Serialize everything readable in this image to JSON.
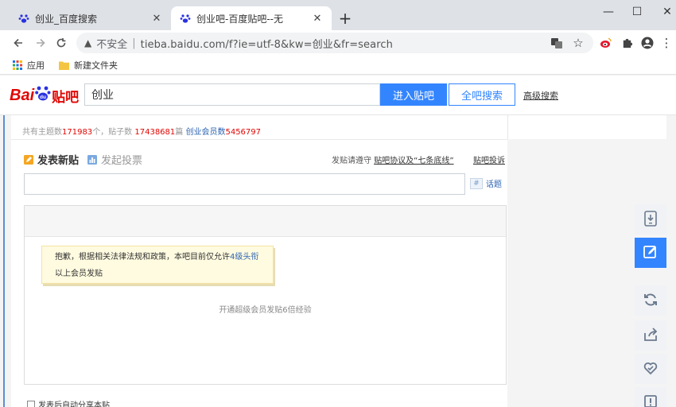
{
  "browser": {
    "tabs": [
      {
        "title": "创业_百度搜索",
        "active": false
      },
      {
        "title": "创业吧-百度贴吧--无",
        "active": true
      }
    ],
    "new_tab": "+",
    "window_controls": {
      "minimize": "—",
      "maximize": "☐",
      "close": "✕"
    },
    "address": {
      "security_label": "不安全",
      "separator": "|",
      "url": "tieba.baidu.com/f?ie=utf-8&kw=创业&fr=search"
    },
    "bookmarks": [
      {
        "label": "应用",
        "icon": "apps-grid-icon"
      },
      {
        "label": "新建文件夹",
        "icon": "folder-icon"
      }
    ]
  },
  "header": {
    "logo": {
      "bai": "Bai",
      "du": "du",
      "tieba": "贴吧"
    },
    "search_value": "创业",
    "enter_button": "进入贴吧",
    "all_search_button": "全吧搜索",
    "advanced_link": "高级搜索"
  },
  "stats": {
    "topics_label": "共有主题数",
    "topics_value": "171983",
    "topics_unit": "个，贴子数 ",
    "posts_value": "17438681",
    "posts_unit": "篇 ",
    "members_link": "创业会员数",
    "members_value": "5456797"
  },
  "post": {
    "new_post_tab": "发表新贴",
    "vote_tab": "发起投票",
    "rules_prefix": "发贴请遵守 ",
    "rules_link": "贴吧协议及“七条底线”",
    "report_link": "贴吧投诉",
    "topic_label": "话题",
    "topic_hash": "#",
    "notice_text_a": "抱歉，根据相关法律法规和政策，本吧目前仅允许",
    "notice_highlight": "4级头衔",
    "notice_text_b": "以上会员发贴",
    "editor_hint": "开通超级会员发贴6倍经验",
    "share_label": "发表后自动分享本贴"
  },
  "colors": {
    "accent": "#3385ff",
    "brand_red": "#e10602",
    "brand_blue": "#2932e1",
    "link": "#2d64b3",
    "notice_bg": "#fffbe0"
  },
  "side_tools": [
    "download-app-icon",
    "edit-post-icon",
    "refresh-icon",
    "share-icon",
    "favorite-heart-icon",
    "report-icon"
  ]
}
